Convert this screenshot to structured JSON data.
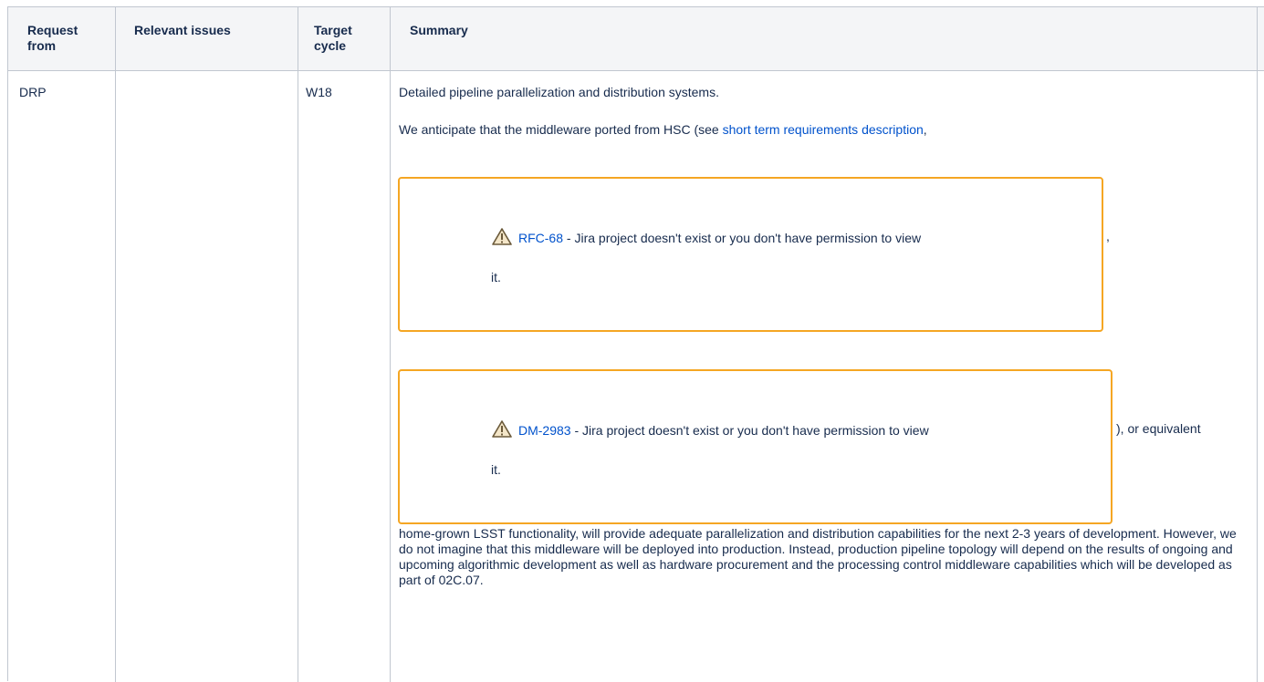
{
  "table": {
    "headers": {
      "request_from": "Request from",
      "relevant_issues": "Relevant issues",
      "target_cycle": "Target cycle",
      "summary": "Summary"
    },
    "row": {
      "request_from": "DRP",
      "relevant_issues": "",
      "target_cycle": "W18",
      "summary_line1": "Detailed pipeline parallelization and distribution systems.",
      "summary_line2_prefix": "We anticipate that the middleware ported from HSC (see ",
      "summary_link": "short term requirements description",
      "summary_line2_suffix": ",",
      "jira_issues": [
        {
          "key": "RFC-68",
          "message_a": " - Jira project doesn't exist or you don't have permission to view",
          "message_b": "it.",
          "trailing": ","
        },
        {
          "key": "DM-2983",
          "message_a": " - Jira project doesn't exist or you don't have permission to view",
          "message_b": "it.",
          "trailing": "), or equivalent"
        }
      ],
      "summary_paragraph": "home-grown LSST functionality, will provide adequate parallelization and distribution capabilities for the next 2-3 years of development. However, we do not imagine that this middleware will be deployed into production. Instead, production pipeline topology will depend on the results of ongoing and upcoming algorithmic development as well as hardware procurement and the processing control middleware capabilities which will be developed as part of 02C.07."
    }
  },
  "colors": {
    "border": "#c1c7d0",
    "header_bg": "#f4f5f7",
    "link": "#0052cc",
    "jira_box_border": "#f5a623",
    "text": "#172b4d"
  },
  "icons": {
    "jira_warning": "warning-triangle-icon"
  }
}
